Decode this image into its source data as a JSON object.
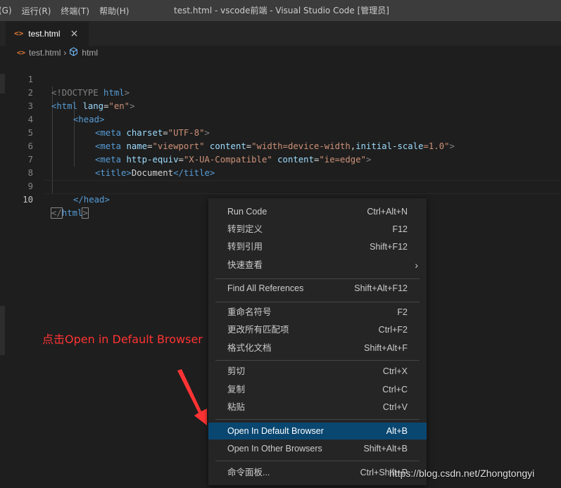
{
  "titlebar": {
    "menus": [
      "(G)",
      "运行(R)",
      "终端(T)",
      "帮助(H)"
    ],
    "title": "test.html - vscode前端 - Visual Studio Code [管理员]"
  },
  "tab": {
    "icon": "html-file-icon",
    "label": "test.html",
    "close": "×"
  },
  "breadcrumb": {
    "file": "test.html",
    "symbol": "html"
  },
  "editor": {
    "line_numbers": [
      "1",
      "2",
      "3",
      "4",
      "5",
      "6",
      "7",
      "8",
      "9",
      "10"
    ],
    "lines": {
      "l1": {
        "open": "<!DOCTYPE",
        "name": "html",
        "close": ">"
      },
      "l2": {
        "open": "<html",
        "attr": "lang",
        "eq": "=",
        "val": "\"en\"",
        "close": ">"
      },
      "l3": {
        "text": "<head>"
      },
      "l4": {
        "open": "<meta",
        "attr": "charset",
        "eq": "=",
        "val": "\"UTF-8\"",
        "close": ">"
      },
      "l5": {
        "open": "<meta",
        "a1": "name",
        "v1": "\"viewport\"",
        "a2": "content",
        "v2": "\"width=device-width",
        "comma": ",",
        "a3": "initial-scale",
        "v3": "=1.0\"",
        "close": ">"
      },
      "l6": {
        "open": "<meta",
        "a1": "http-equiv",
        "v1": "\"X-UA-Compatible\"",
        "a2": "content",
        "v2": "\"ie=edge\"",
        "close": ">"
      },
      "l7": {
        "open": "<title>",
        "text": "Document",
        "close": "</title>"
      },
      "l9": {
        "text": "</head>"
      },
      "l10": {
        "open": "</",
        "name": "html",
        "close": ">"
      }
    }
  },
  "context_menu": {
    "items": [
      {
        "label": "Run Code",
        "key": "Ctrl+Alt+N"
      },
      {
        "label": "转到定义",
        "key": "F12"
      },
      {
        "label": "转到引用",
        "key": "Shift+F12"
      },
      {
        "label": "快速查看",
        "key": "›"
      },
      {
        "label": "Find All References",
        "key": "Shift+Alt+F12"
      },
      {
        "label": "重命名符号",
        "key": "F2"
      },
      {
        "label": "更改所有匹配项",
        "key": "Ctrl+F2"
      },
      {
        "label": "格式化文档",
        "key": "Shift+Alt+F"
      },
      {
        "label": "剪切",
        "key": "Ctrl+X"
      },
      {
        "label": "复制",
        "key": "Ctrl+C"
      },
      {
        "label": "粘贴",
        "key": "Ctrl+V"
      },
      {
        "label": "Open In Default Browser",
        "key": "Alt+B"
      },
      {
        "label": "Open In Other Browsers",
        "key": "Shift+Alt+B"
      },
      {
        "label": "命令面板...",
        "key": "Ctrl+Shift+P"
      }
    ]
  },
  "annotation": {
    "text": "点击Open in Default Browser",
    "color": "#ff3333"
  },
  "watermark": "https://blog.csdn.net/Zhongtongyi",
  "colors": {
    "selection": "#094771",
    "tag": "#569cd6",
    "attribute": "#9cdcfe",
    "string": "#ce9178"
  }
}
